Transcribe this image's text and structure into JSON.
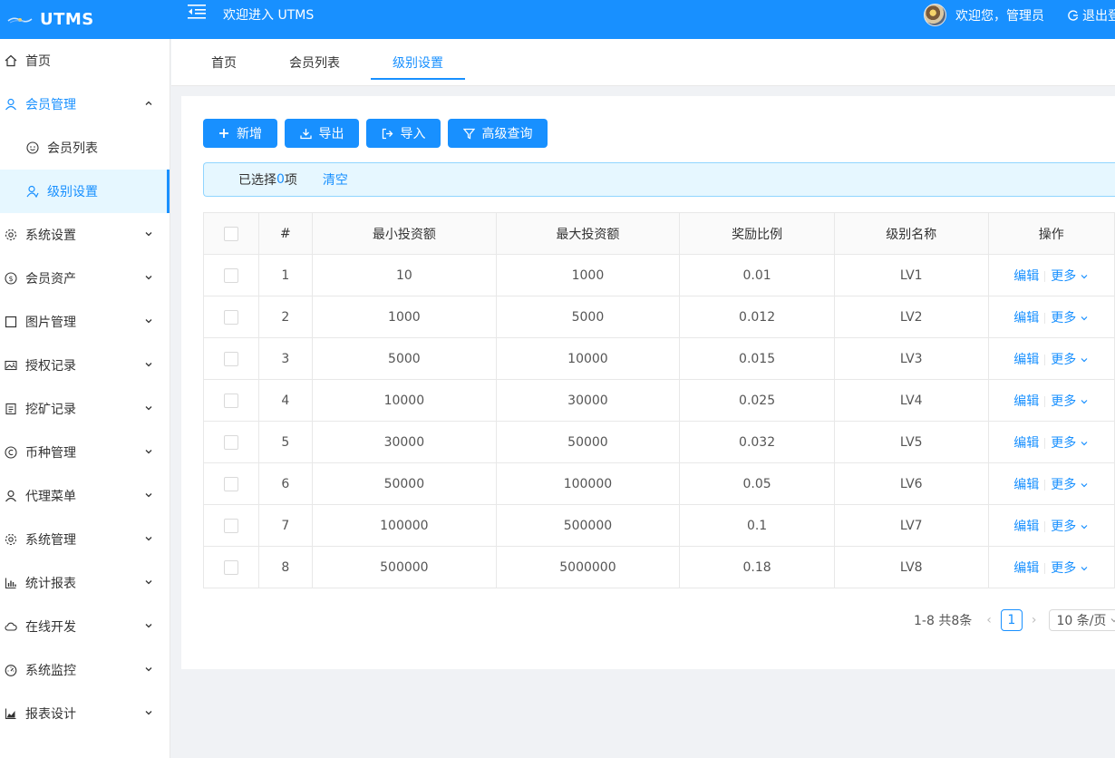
{
  "header": {
    "brand": "UTMS",
    "welcome": "欢迎进入 UTMS",
    "user_greeting": "欢迎您，管理员",
    "logout": "退出登录"
  },
  "sidebar": {
    "items": [
      {
        "label": "首页",
        "icon": "home-icon"
      },
      {
        "label": "会员管理",
        "icon": "user-icon",
        "open": true
      },
      {
        "label": "会员列表",
        "icon": "smile-icon",
        "sub": true
      },
      {
        "label": "级别设置",
        "icon": "user-level-icon",
        "sub": true,
        "active": true
      },
      {
        "label": "系统设置",
        "icon": "gear-icon"
      },
      {
        "label": "会员资产",
        "icon": "dollar-icon"
      },
      {
        "label": "图片管理",
        "icon": "square-icon"
      },
      {
        "label": "授权记录",
        "icon": "picture-icon"
      },
      {
        "label": "挖矿记录",
        "icon": "file-icon"
      },
      {
        "label": "币种管理",
        "icon": "copyright-icon"
      },
      {
        "label": "代理菜单",
        "icon": "user-icon"
      },
      {
        "label": "系统管理",
        "icon": "gear-icon"
      },
      {
        "label": "统计报表",
        "icon": "bar-chart-icon"
      },
      {
        "label": "在线开发",
        "icon": "cloud-icon"
      },
      {
        "label": "系统监控",
        "icon": "dashboard-icon"
      },
      {
        "label": "报表设计",
        "icon": "area-chart-icon"
      }
    ]
  },
  "tabs": [
    {
      "label": "首页"
    },
    {
      "label": "会员列表"
    },
    {
      "label": "级别设置",
      "active": true
    }
  ],
  "toolbar": {
    "add": "新增",
    "export": "导出",
    "import": "导入",
    "advanced_query": "高级查询"
  },
  "selection": {
    "prefix": "已选择 ",
    "count": "0",
    "suffix": "项",
    "clear": "清空"
  },
  "table": {
    "headers": [
      "#",
      "最小投资额",
      "最大投资额",
      "奖励比例",
      "级别名称",
      "操作"
    ],
    "rows": [
      [
        "1",
        "10",
        "1000",
        "0.01",
        "LV1"
      ],
      [
        "2",
        "1000",
        "5000",
        "0.012",
        "LV2"
      ],
      [
        "3",
        "5000",
        "10000",
        "0.015",
        "LV3"
      ],
      [
        "4",
        "10000",
        "30000",
        "0.025",
        "LV4"
      ],
      [
        "5",
        "30000",
        "50000",
        "0.032",
        "LV5"
      ],
      [
        "6",
        "50000",
        "100000",
        "0.05",
        "LV6"
      ],
      [
        "7",
        "100000",
        "500000",
        "0.1",
        "LV7"
      ],
      [
        "8",
        "500000",
        "5000000",
        "0.18",
        "LV8"
      ]
    ],
    "edit_label": "编辑",
    "more_label": "更多"
  },
  "pagination": {
    "total": "1-8 共8条",
    "current": "1",
    "page_size": "10 条/页"
  },
  "colors": {
    "primary": "#1890ff",
    "alert_bg": "#e6f7ff"
  }
}
